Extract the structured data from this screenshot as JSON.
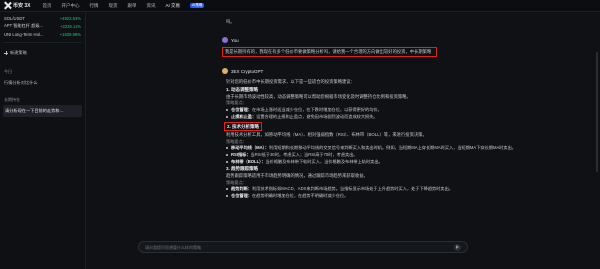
{
  "app": {
    "logo_text": "币安 3X",
    "brand_color": "#2a5cff",
    "up_color": "#22c27a",
    "highlight_color": "#e02020"
  },
  "nav": {
    "items": [
      "首页",
      "开户中心",
      "行情",
      "现货",
      "跟单",
      "资讯"
    ],
    "ai_label": "AI 交易",
    "ai_badge": "AI策略"
  },
  "sidebar": {
    "tickers": [
      {
        "name": "SOL/USDT",
        "change": "+4923.53%"
      },
      {
        "name": "APT 智能杠杆 超级...",
        "change": "+2229.11%"
      },
      {
        "name": "UNI Long-Term Hol...",
        "change": "+1839.98%"
      }
    ],
    "new_chat": "新建策略",
    "items": [
      "今日",
      "行情分析对比什么",
      "长期持仓",
      "请分析现在一下目前的走势和..."
    ],
    "today_label": "今日",
    "history_label": "长期AI"
  },
  "chat": {
    "top_text": "吗。",
    "user_name": "You",
    "user_msg": "我是长期持有的，我现在有多个低价币要做策略分析吗，请给我一个合理的方向做出较好的投资，中长期策略",
    "bot_name": "3EX CryptoGPT",
    "bot_intro": "针对您的低价币中长期投资需求，以下是一些适合的投资策略建议：",
    "s1_title": "1. 动态调整策略",
    "s1_desc": "由于长期市场波动性较高，动态调整策略可以帮助您根据市场变化及时调整持仓比例和投资策略。",
    "s1_sub": "策略要点：",
    "s1_b1_label": "仓位管理：",
    "s1_b1_text": "在市场上涨时适当减少仓位，在下跌时增加仓位，以获得更好的均价。",
    "s1_b2_label": "止损和止盈：",
    "s1_b2_text": "设置合理的止损和止盈点，避免因市场剧烈波动而造成较大损失。",
    "s2_title": "2. 技术分析策略",
    "s2_desc": "利用技术分析工具，如移动平均线（MA）、相对强弱指数（RSI）、布林带（BOLL）等，来进行投资决策。",
    "s2_sub": "策略要点：",
    "s2_b1_label": "移动平均线（MA）：",
    "s2_b1_text": "利用短期和长期移动平均线的交叉信号来判断买入和卖出时机。例如，当短期MA上穿长期MA时买入，当短期MA下穿长期MA时卖出。",
    "s2_b2_label": "RSI指标：",
    "s2_b2_text": "当RSI低于30时，考虑买入；当RSI高于70时，考虑卖出。",
    "s2_b3_label": "布林带（BOLL）：",
    "s2_b3_text": "当价格触及布林带下轨时买入，当价格触及布林带上轨时卖出。",
    "s3_title": "3. 趋势跟踪策略",
    "s3_desc": "趋势跟踪策略适用于市场趋势明确的情况，通过跟踪市场趋势来获取收益。",
    "s3_sub": "策略要点：",
    "s3_b1_label": "趋势判断：",
    "s3_b1_text": "利用技术指标如MACD、ADX来判断市场趋势。当指标显示市场处于上升趋势时买入，处于下降趋势时卖出。",
    "s3_b2_label": "仓位管理：",
    "s3_b2_text": "在趋势明确时增加仓位，在趋势不明确时减少仓位。"
  },
  "input": {
    "placeholder": "请向我提问您想要什么样的策略"
  }
}
